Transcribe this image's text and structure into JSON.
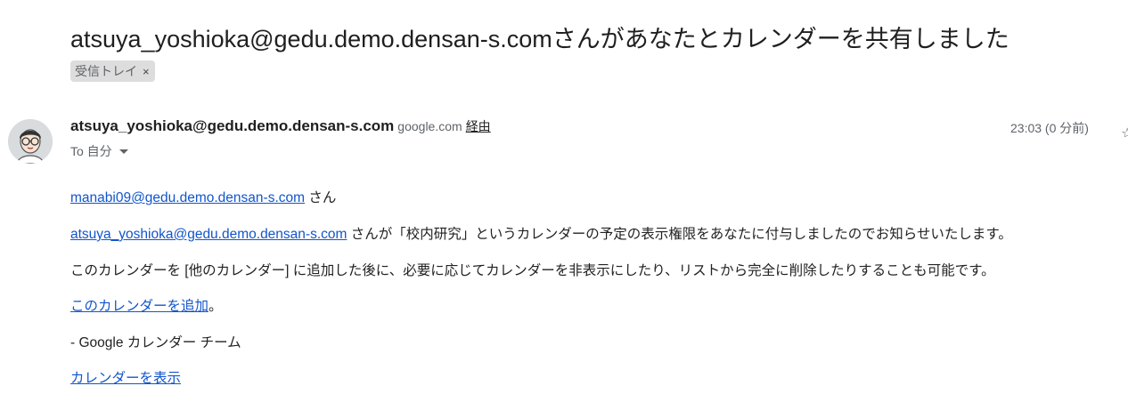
{
  "email": {
    "subject": "atsuya_yoshioka@gedu.demo.densan-s.comさんがあなたとカレンダーを共有しました",
    "label": {
      "name": "受信トレイ",
      "remove": "×"
    },
    "sender": {
      "name": "atsuya_yoshioka@gedu.demo.densan-s.com",
      "via_domain": "google.com",
      "via_label": "経由"
    },
    "time": "23:03 (0 分前)",
    "to_label": "To 自分",
    "body": {
      "greeting_email": "manabi09@gedu.demo.densan-s.com",
      "greeting_suffix": " さん",
      "share_email": "atsuya_yoshioka@gedu.demo.densan-s.com",
      "share_text": " さんが「校内研究」というカレンダーの予定の表示権限をあなたに付与しましたのでお知らせいたします。",
      "info_text": "このカレンダーを [他のカレンダー] に追加した後に、必要に応じてカレンダーを非表示にしたり、リストから完全に削除したりすることも可能です。",
      "add_link": "このカレンダーを追加",
      "add_suffix": "。",
      "signature": "- Google カレンダー チーム",
      "view_link": "カレンダーを表示"
    }
  }
}
